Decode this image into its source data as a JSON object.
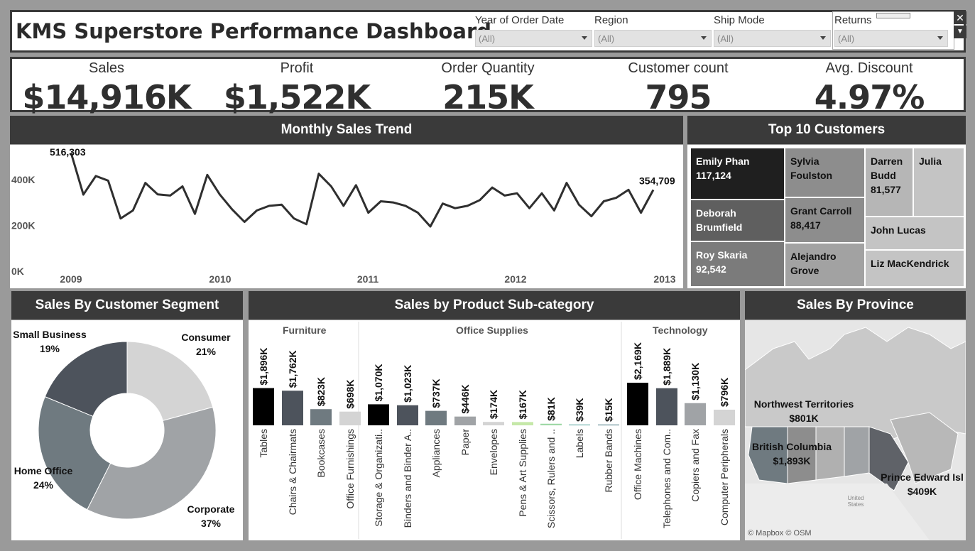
{
  "dashboard": {
    "title": "KMS Superstore Performance Dashboard"
  },
  "filters": [
    {
      "label": "Year of Order Date",
      "value": "(All)"
    },
    {
      "label": "Region",
      "value": "(All)"
    },
    {
      "label": "Ship Mode",
      "value": "(All)"
    },
    {
      "label": "Returns",
      "value": "(All)"
    }
  ],
  "kpis": [
    {
      "label": "Sales",
      "value": "$14,916K"
    },
    {
      "label": "Profit",
      "value": "$1,522K"
    },
    {
      "label": "Order Quantity",
      "value": "215K"
    },
    {
      "label": "Customer count",
      "value": "795"
    },
    {
      "label": "Avg. Discount",
      "value": "4.97%"
    }
  ],
  "trend": {
    "title": "Monthly Sales Trend",
    "y_ticks": [
      "400K",
      "200K",
      "0K"
    ],
    "x_ticks": [
      "2009",
      "2010",
      "2011",
      "2012",
      "2013"
    ],
    "first_label": "516,303",
    "last_label": "354,709"
  },
  "customers": {
    "title": "Top 10 Customers",
    "items": [
      {
        "name": "Emily Phan",
        "value": "117,124",
        "color": "#1f1f1f"
      },
      {
        "name": "Sylvia Foulston",
        "value": "",
        "color": "#8d8d8d"
      },
      {
        "name": "Darren Budd",
        "value": "81,577",
        "color": "#b6b6b6"
      },
      {
        "name": "Julia",
        "value": "",
        "color": "#c4c4c4"
      },
      {
        "name": "Deborah Brumfield",
        "value": "",
        "color": "#5f5f5f"
      },
      {
        "name": "Grant Carroll",
        "value": "88,417",
        "color": "#8d8d8d"
      },
      {
        "name": "John Lucas",
        "value": "",
        "color": "#c4c4c4"
      },
      {
        "name": "Roy Skaria",
        "value": "92,542",
        "color": "#7b7b7b"
      },
      {
        "name": "Alejandro Grove",
        "value": "",
        "color": "#a2a2a2"
      },
      {
        "name": "Liz MacKendrick",
        "value": "",
        "color": "#c4c4c4"
      }
    ]
  },
  "segment": {
    "title": "Sales By Customer Segment",
    "slices": [
      {
        "name": "Consumer",
        "pct": "21%",
        "value": 21,
        "color": "#d4d4d4"
      },
      {
        "name": "Corporate",
        "pct": "37%",
        "value": 37,
        "color": "#a0a3a6"
      },
      {
        "name": "Home Office",
        "pct": "24%",
        "value": 24,
        "color": "#6f7a80"
      },
      {
        "name": "Small Business",
        "pct": "19%",
        "value": 19,
        "color": "#4d535c"
      }
    ]
  },
  "subcat": {
    "title": "Sales by Product Sub-category",
    "groups": [
      "Furniture",
      "Office Supplies",
      "Technology"
    ],
    "bars": [
      {
        "name": "Tables",
        "label": "$1,896K",
        "value": 1896,
        "color": "#000000"
      },
      {
        "name": "Chairs & Chairmats",
        "label": "$1,762K",
        "value": 1762,
        "color": "#4d535c"
      },
      {
        "name": "Bookcases",
        "label": "$823K",
        "value": 823,
        "color": "#6f7a80"
      },
      {
        "name": "Office Furnishings",
        "label": "$698K",
        "value": 698,
        "color": "#d4d4d4"
      },
      {
        "name": "Storage & Organizati..",
        "label": "$1,070K",
        "value": 1070,
        "color": "#000000"
      },
      {
        "name": "Binders and Binder A..",
        "label": "$1,023K",
        "value": 1023,
        "color": "#4d535c"
      },
      {
        "name": "Appliances",
        "label": "$737K",
        "value": 737,
        "color": "#6f7a80"
      },
      {
        "name": "Paper",
        "label": "$446K",
        "value": 446,
        "color": "#a0a3a6"
      },
      {
        "name": "Envelopes",
        "label": "$174K",
        "value": 174,
        "color": "#d4d4d4"
      },
      {
        "name": "Pens & Art Supplies",
        "label": "$167K",
        "value": 167,
        "color": "#c5e8a8"
      },
      {
        "name": "Scissors, Rulers and ..",
        "label": "$81K",
        "value": 81,
        "color": "#9fd9a6"
      },
      {
        "name": "Labels",
        "label": "$39K",
        "value": 39,
        "color": "#5aa8a0"
      },
      {
        "name": "Rubber Bands",
        "label": "$15K",
        "value": 15,
        "color": "#3b6f7a"
      },
      {
        "name": "Office Machines",
        "label": "$2,169K",
        "value": 2169,
        "color": "#000000"
      },
      {
        "name": "Telephones and Com..",
        "label": "$1,889K",
        "value": 1889,
        "color": "#4d535c"
      },
      {
        "name": "Copiers and Fax",
        "label": "$1,130K",
        "value": 1130,
        "color": "#a0a3a6"
      },
      {
        "name": "Computer Peripherals",
        "label": "$796K",
        "value": 796,
        "color": "#d4d4d4"
      }
    ]
  },
  "province": {
    "title": "Sales By Province",
    "labels": [
      {
        "name": "Northwest Territories",
        "value": "$801K"
      },
      {
        "name": "British Columbia",
        "value": "$1,893K"
      },
      {
        "name": "Prince Edward Isl",
        "value": "$409K"
      }
    ],
    "us_label": "United States",
    "attribution": "© Mapbox © OSM"
  },
  "chart_data": [
    {
      "type": "line",
      "title": "Monthly Sales Trend",
      "x": [
        "2009-01",
        "2009-02",
        "2009-03",
        "2009-04",
        "2009-05",
        "2009-06",
        "2009-07",
        "2009-08",
        "2009-09",
        "2009-10",
        "2009-11",
        "2009-12",
        "2010-01",
        "2010-02",
        "2010-03",
        "2010-04",
        "2010-05",
        "2010-06",
        "2010-07",
        "2010-08",
        "2010-09",
        "2010-10",
        "2010-11",
        "2010-12",
        "2011-01",
        "2011-02",
        "2011-03",
        "2011-04",
        "2011-05",
        "2011-06",
        "2011-07",
        "2011-08",
        "2011-09",
        "2011-10",
        "2011-11",
        "2011-12",
        "2012-01",
        "2012-02",
        "2012-03",
        "2012-04",
        "2012-05",
        "2012-06",
        "2012-07",
        "2012-08",
        "2012-09",
        "2012-10",
        "2012-11",
        "2012-12"
      ],
      "y": [
        516303,
        334000,
        415000,
        395000,
        230000,
        265000,
        385000,
        335000,
        330000,
        370000,
        250000,
        420000,
        335000,
        270000,
        215000,
        265000,
        285000,
        290000,
        230000,
        205000,
        425000,
        370000,
        285000,
        375000,
        255000,
        305000,
        300000,
        285000,
        255000,
        195000,
        295000,
        275000,
        285000,
        310000,
        365000,
        330000,
        340000,
        275000,
        340000,
        265000,
        385000,
        290000,
        240000,
        305000,
        320000,
        355000,
        255000,
        354709
      ],
      "ylim": [
        0,
        520000
      ],
      "y_ticks": [
        "400K",
        "200K",
        "0K"
      ],
      "x_ticks": [
        "2009",
        "2010",
        "2011",
        "2012",
        "2013"
      ]
    },
    {
      "type": "pie",
      "title": "Sales By Customer Segment",
      "categories": [
        "Consumer",
        "Corporate",
        "Home Office",
        "Small Business"
      ],
      "values": [
        21,
        37,
        24,
        19
      ]
    },
    {
      "type": "bar",
      "title": "Sales by Product Sub-category",
      "categories": [
        "Tables",
        "Chairs & Chairmats",
        "Bookcases",
        "Office Furnishings",
        "Storage & Organizati..",
        "Binders and Binder A..",
        "Appliances",
        "Paper",
        "Envelopes",
        "Pens & Art Supplies",
        "Scissors, Rulers and ..",
        "Labels",
        "Rubber Bands",
        "Office Machines",
        "Telephones and Com..",
        "Copiers and Fax",
        "Computer Peripherals"
      ],
      "values": [
        1896,
        1762,
        823,
        698,
        1070,
        1023,
        737,
        446,
        174,
        167,
        81,
        39,
        15,
        2169,
        1889,
        1130,
        796
      ]
    }
  ]
}
